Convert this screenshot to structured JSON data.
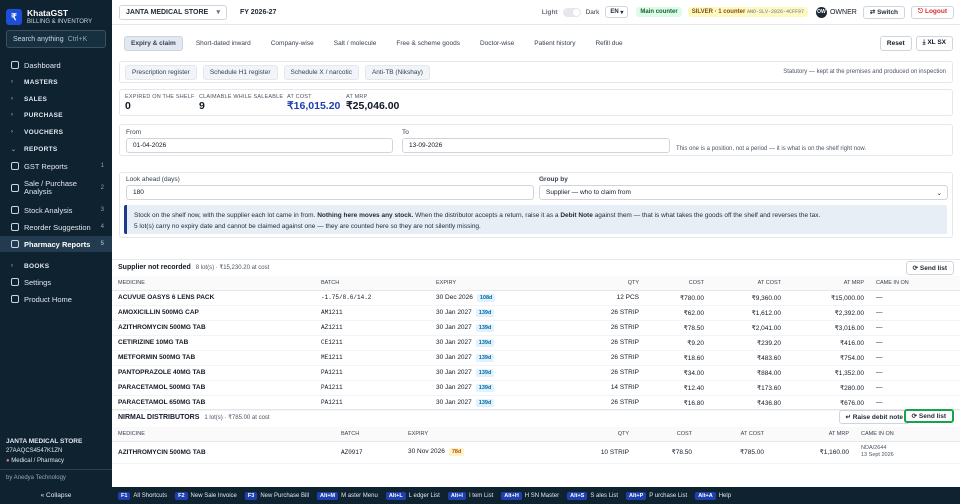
{
  "app": {
    "name": "KhataGST",
    "subtitle": "BILLING & INVENTORY",
    "logo_glyph": "₹"
  },
  "sidebar": {
    "search_placeholder": "Search anything",
    "search_shortcut": "Ctrl+K",
    "items": [
      {
        "label": "Dashboard",
        "type": "item"
      },
      {
        "label": "MASTERS",
        "type": "group"
      },
      {
        "label": "SALES",
        "type": "group"
      },
      {
        "label": "PURCHASE",
        "type": "group"
      },
      {
        "label": "VOUCHERS",
        "type": "group"
      },
      {
        "label": "REPORTS",
        "type": "group-open"
      },
      {
        "label": "GST Reports",
        "count": "1"
      },
      {
        "label": "Sale / Purchase Analysis",
        "count": "2"
      },
      {
        "label": "Stock Analysis",
        "count": "3"
      },
      {
        "label": "Reorder Suggestion",
        "count": "4"
      },
      {
        "label": "Pharmacy Reports",
        "count": "5"
      },
      {
        "label": "BOOKS",
        "type": "group"
      },
      {
        "label": "Settings",
        "type": "item"
      },
      {
        "label": "Product Home",
        "type": "item"
      }
    ],
    "company_name": "JANTA MEDICAL STORE",
    "gstin": "27AAQCS4547K1ZN",
    "business_type": "Medical / Pharmacy",
    "by_line": "by Anedya Technology",
    "collapse_label": "« Collapse"
  },
  "topbar": {
    "company": "JANTA MEDICAL STORE",
    "fy": "FY 2026-27",
    "theme_light": "Light",
    "theme_dark": "Dark",
    "lang": "EN",
    "counter": "Main counter",
    "plan": "SILVER · 1 counter",
    "license": "ANO-SLV-2026-4CFF97",
    "user_initials": "OW",
    "user_role": "OWNER",
    "switch_label": "⇄ Switch",
    "logout_label": "⎋ Logout"
  },
  "tabs": [
    "Expiry & claim",
    "Short-dated inward",
    "Company-wise",
    "Salt / molecule",
    "Free & scheme goods",
    "Doctor-wise",
    "Patient history",
    "Refill due"
  ],
  "reset_label": "Reset",
  "xlsx_label": "⤓ XL SX",
  "registers": [
    "Prescription register",
    "Schedule H1 register",
    "Schedule X / narcotic",
    "Anti-TB (Nikshay)"
  ],
  "statutory_note": "Statutory — kept at the premises and produced on inspection",
  "kpis": [
    {
      "label": "EXPIRED ON THE SHELF",
      "value": "0"
    },
    {
      "label": "CLAIMABLE WHILE SALEABLE",
      "value": "9"
    },
    {
      "label": "AT COST",
      "value": "₹16,015.20",
      "accent": "#1e40af"
    },
    {
      "label": "AT MRP",
      "value": "₹25,046.00"
    }
  ],
  "filters": {
    "from_label": "From",
    "from_value": "01-04-2026",
    "to_label": "To",
    "to_value": "13-09-2026",
    "date_note": "This one is a position, not a period — it is what is on the shelf right now.",
    "lookahead_label": "Look ahead (days)",
    "lookahead_value": "180",
    "groupby_label": "Group by",
    "groupby_value": "Supplier — who to claim from"
  },
  "info": {
    "pre": "Stock on the shelf now, with the supplier each lot came in from. ",
    "bold1": "Nothing here moves any stock.",
    "mid": " When the distributor accepts a return, raise it as a ",
    "bold2": "Debit Note",
    "post": " against them — that is what takes the goods off the shelf and reverses the tax.",
    "line2": "5 lot(s) carry no expiry date and cannot be claimed against one — they are counted here so they are not silently missing."
  },
  "group1": {
    "title": "Supplier not recorded",
    "summary": "8 lot(s) · ₹15,230.20 at cost",
    "send_label": "⟳ Send list",
    "headers": [
      "MEDICINE",
      "BATCH",
      "EXPIRY",
      "QTY",
      "COST",
      "AT COST",
      "AT MRP",
      "CAME IN ON"
    ],
    "rows": [
      {
        "medicine": "ACUVUE OASYS 6 LENS PACK",
        "batch": "-1.75/8.6/14.2",
        "expiry": "30 Dec 2026",
        "days": "108d",
        "qty": "12 PCS",
        "cost": "₹780.00",
        "at_cost": "₹9,360.00",
        "at_mrp": "₹15,000.00",
        "came_in": "—"
      },
      {
        "medicine": "AMOXICILLIN 500MG CAP",
        "batch": "AM1211",
        "expiry": "30 Jan 2027",
        "days": "139d",
        "qty": "26 STRIP",
        "cost": "₹62.00",
        "at_cost": "₹1,612.00",
        "at_mrp": "₹2,392.00",
        "came_in": "—"
      },
      {
        "medicine": "AZITHROMYCIN 500MG TAB",
        "batch": "AZ1211",
        "expiry": "30 Jan 2027",
        "days": "139d",
        "qty": "26 STRIP",
        "cost": "₹78.50",
        "at_cost": "₹2,041.00",
        "at_mrp": "₹3,016.00",
        "came_in": "—"
      },
      {
        "medicine": "CETIRIZINE 10MG TAB",
        "batch": "CE1211",
        "expiry": "30 Jan 2027",
        "days": "139d",
        "qty": "26 STRIP",
        "cost": "₹9.20",
        "at_cost": "₹239.20",
        "at_mrp": "₹416.00",
        "came_in": "—"
      },
      {
        "medicine": "METFORMIN 500MG TAB",
        "batch": "ME1211",
        "expiry": "30 Jan 2027",
        "days": "139d",
        "qty": "26 STRIP",
        "cost": "₹18.60",
        "at_cost": "₹483.60",
        "at_mrp": "₹754.00",
        "came_in": "—"
      },
      {
        "medicine": "PANTOPRAZOLE 40MG TAB",
        "batch": "PA1211",
        "expiry": "30 Jan 2027",
        "days": "139d",
        "qty": "26 STRIP",
        "cost": "₹34.00",
        "at_cost": "₹884.00",
        "at_mrp": "₹1,352.00",
        "came_in": "—"
      },
      {
        "medicine": "PARACETAMOL 500MG TAB",
        "batch": "PA1211",
        "expiry": "30 Jan 2027",
        "days": "139d",
        "qty": "14 STRIP",
        "cost": "₹12.40",
        "at_cost": "₹173.60",
        "at_mrp": "₹280.00",
        "came_in": "—"
      },
      {
        "medicine": "PARACETAMOL 650MG TAB",
        "batch": "PA1211",
        "expiry": "30 Jan 2027",
        "days": "139d",
        "qty": "26 STRIP",
        "cost": "₹16.80",
        "at_cost": "₹436.80",
        "at_mrp": "₹676.00",
        "came_in": "—"
      }
    ]
  },
  "group2": {
    "title": "NIRMAL DISTRIBUTORS",
    "summary": "1 lot(s) · ₹785.00 at cost",
    "debit_label": "↵ Raise debit note",
    "send_label": "⟳ Send list",
    "headers": [
      "MEDICINE",
      "BATCH",
      "EXPIRY",
      "QTY",
      "COST",
      "AT COST",
      "AT MRP",
      "CAME IN ON"
    ],
    "rows": [
      {
        "medicine": "AZITHROMYCIN 500MG TAB",
        "batch": "AZ0917",
        "expiry": "30 Nov 2026",
        "days": "78d",
        "qty": "10 STRIP",
        "cost": "₹78.50",
        "at_cost": "₹785.00",
        "at_mrp": "₹1,160.00",
        "came_in": "NDA/2644",
        "came_in_date": "13 Sept 2026"
      }
    ]
  },
  "shortcuts": [
    {
      "key": "F1",
      "label": "All Shortcuts"
    },
    {
      "key": "F2",
      "label": "New Sale Invoice"
    },
    {
      "key": "F3",
      "label": "New Purchase Bill"
    },
    {
      "key": "Alt+M",
      "label": "M aster Menu"
    },
    {
      "key": "Alt+L",
      "label": "L edger List"
    },
    {
      "key": "Alt+I",
      "label": "I tem List"
    },
    {
      "key": "Alt+H",
      "label": "H SN Master"
    },
    {
      "key": "Alt+S",
      "label": "S ales List"
    },
    {
      "key": "Alt+P",
      "label": "P urchase List"
    },
    {
      "key": "Alt+A",
      "label": "Help"
    }
  ],
  "colors": {
    "sidebar_bg": "#0e2230",
    "accent": "#1e40af",
    "logout": "#dc2626",
    "highlight": "#16a34a"
  }
}
